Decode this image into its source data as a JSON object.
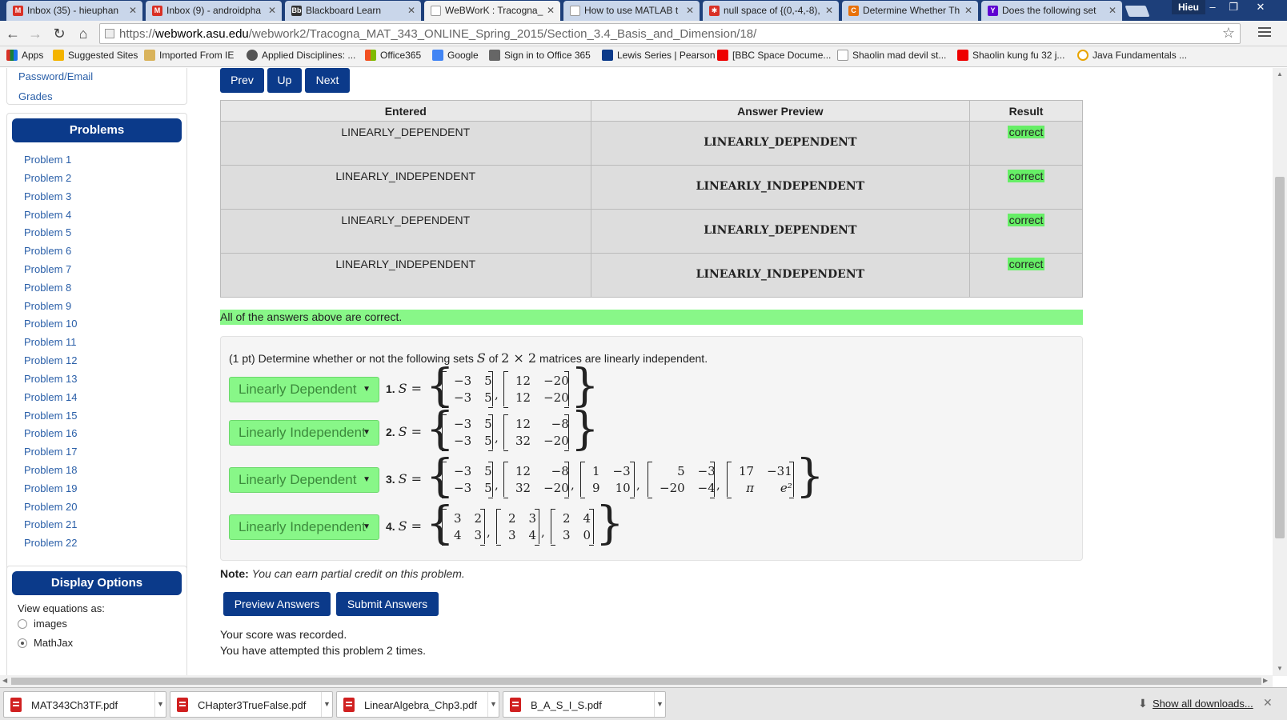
{
  "browser": {
    "tabs": [
      {
        "title": "Inbox (35) - hieuphan",
        "icon_color": "#d93025"
      },
      {
        "title": "Inbox (9) - androidpha",
        "icon_color": "#d93025"
      },
      {
        "title": "Blackboard Learn",
        "icon_color": "#333333"
      },
      {
        "title": "WeBWorK : Tracogna_",
        "icon_color": "#ffffff"
      },
      {
        "title": "How to use MATLAB t",
        "icon_color": "#ffffff"
      },
      {
        "title": "null space of {(0,-4,-8),",
        "icon_color": "#d93025"
      },
      {
        "title": "Determine Whether Th",
        "icon_color": "#e8710a"
      },
      {
        "title": "Does the following set",
        "icon_color": "#5f01d1"
      }
    ],
    "user": "Hieu",
    "url": {
      "scheme": "https://",
      "host": "webwork.asu.edu",
      "path": "/webwork2/Tracogna_MAT_343_ONLINE_Spring_2015/Section_3.4_Basis_and_Dimension/18/"
    },
    "bookmarks": [
      "Apps",
      "Suggested Sites",
      "Imported From IE",
      "Applied Disciplines: ...",
      "Office365",
      "Google",
      "Sign in to Office 365",
      "Lewis Series | Pearson",
      "[BBC Space Docume...",
      "Shaolin mad devil st...",
      "Shaolin kung fu 32 j...",
      "Java Fundamentals ..."
    ]
  },
  "sidebar": {
    "links": [
      "Password/Email",
      "Grades"
    ],
    "problems_heading": "Problems",
    "problems": [
      "Problem 1",
      "Problem 2",
      "Problem 3",
      "Problem 4",
      "Problem 5",
      "Problem 6",
      "Problem 7",
      "Problem 8",
      "Problem 9",
      "Problem 10",
      "Problem 11",
      "Problem 12",
      "Problem 13",
      "Problem 14",
      "Problem 15",
      "Problem 16",
      "Problem 17",
      "Problem 18",
      "Problem 19",
      "Problem 20",
      "Problem 21",
      "Problem 22"
    ],
    "display_heading": "Display Options",
    "view_label": "View equations as:",
    "view_options": [
      "images",
      "MathJax"
    ],
    "view_selected": "MathJax"
  },
  "nav": {
    "prev": "Prev",
    "up": "Up",
    "next": "Next"
  },
  "results": {
    "headers": [
      "Entered",
      "Answer Preview",
      "Result"
    ],
    "rows": [
      {
        "entered": "LINEARLY_DEPENDENT",
        "preview": "LINEARLY_DEPENDENT",
        "result": "correct"
      },
      {
        "entered": "LINEARLY_INDEPENDENT",
        "preview": "LINEARLY_INDEPENDENT",
        "result": "correct"
      },
      {
        "entered": "LINEARLY_DEPENDENT",
        "preview": "LINEARLY_DEPENDENT",
        "result": "correct"
      },
      {
        "entered": "LINEARLY_INDEPENDENT",
        "preview": "LINEARLY_INDEPENDENT",
        "result": "correct"
      }
    ],
    "summary": "All of the answers above are correct."
  },
  "problem": {
    "intro_pre": "(1 pt) Determine whether or not the following sets",
    "intro_set": "S",
    "intro_of": "of",
    "intro_dims": "2 × 2",
    "intro_post": "matrices are linearly independent.",
    "set_symbol": "S =",
    "parts": [
      {
        "answer": "Linearly Dependent",
        "label": "1.",
        "matrices": [
          [
            [
              "−3",
              "5"
            ],
            [
              "−3",
              "5"
            ]
          ],
          [
            [
              "12",
              "−20"
            ],
            [
              "12",
              "−20"
            ]
          ]
        ]
      },
      {
        "answer": "Linearly Independent",
        "label": "2.",
        "matrices": [
          [
            [
              "−3",
              "5"
            ],
            [
              "−3",
              "5"
            ]
          ],
          [
            [
              "12",
              "−8"
            ],
            [
              "32",
              "−20"
            ]
          ]
        ]
      },
      {
        "answer": "Linearly Dependent",
        "label": "3.",
        "matrices": [
          [
            [
              "−3",
              "5"
            ],
            [
              "−3",
              "5"
            ]
          ],
          [
            [
              "12",
              "−8"
            ],
            [
              "32",
              "−20"
            ]
          ],
          [
            [
              "1",
              "−3"
            ],
            [
              "9",
              "10"
            ]
          ],
          [
            [
              "5",
              "−3"
            ],
            [
              "−20",
              "−4"
            ]
          ],
          [
            [
              "17",
              "−31"
            ],
            [
              "π",
              "e²"
            ]
          ]
        ]
      },
      {
        "answer": "Linearly Independent",
        "label": "4.",
        "matrices": [
          [
            [
              "3",
              "2"
            ],
            [
              "4",
              "3"
            ]
          ],
          [
            [
              "2",
              "3"
            ],
            [
              "3",
              "4"
            ]
          ],
          [
            [
              "2",
              "4"
            ],
            [
              "3",
              "0"
            ]
          ]
        ]
      }
    ]
  },
  "note": {
    "label": "Note:",
    "text": "You can earn partial credit on this problem."
  },
  "actions": {
    "preview": "Preview Answers",
    "submit": "Submit Answers"
  },
  "status": [
    "Your score was recorded.",
    "You have attempted this problem 2 times."
  ],
  "downloads": {
    "files": [
      "MAT343Ch3TF.pdf",
      "CHapter3TrueFalse.pdf",
      "LinearAlgebra_Chp3.pdf",
      "B_A_S_I_S.pdf"
    ],
    "show_all": "Show all downloads..."
  },
  "colors": {
    "accent": "#0b3a8a",
    "correct": "#66ee66",
    "answer_select": "#88f788"
  }
}
